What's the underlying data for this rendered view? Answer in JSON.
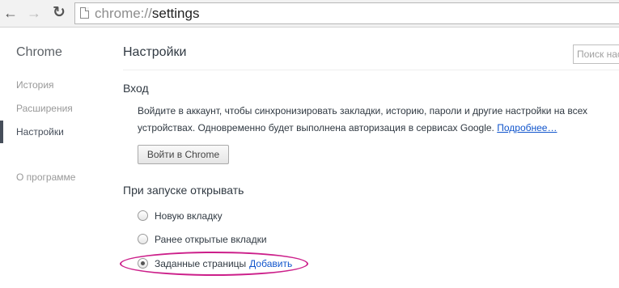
{
  "toolbar": {
    "back_icon": "arrow-left-icon",
    "forward_icon": "arrow-right-icon",
    "reload_icon": "reload-icon",
    "url_scheme": "chrome://",
    "url_host": "settings"
  },
  "sidebar": {
    "brand": "Chrome",
    "items": [
      {
        "label": "История"
      },
      {
        "label": "Расширения"
      },
      {
        "label": "Настройки"
      },
      {
        "label": "О программе"
      }
    ]
  },
  "main": {
    "title": "Настройки",
    "search_placeholder": "Поиск настроек",
    "signin": {
      "heading": "Вход",
      "text": "Войдите в аккаунт, чтобы синхронизировать закладки, историю, пароли и другие настройки на всех устройствах. Одновременно будет выполнена авторизация в сервисах Google. ",
      "more_link": "Подробнее…",
      "button": "Войти в Chrome"
    },
    "startup": {
      "heading": "При запуске открывать",
      "options": [
        {
          "label": "Новую вкладку",
          "checked": false
        },
        {
          "label": "Ранее открытые вкладки",
          "checked": false
        },
        {
          "label": "Заданные страницы",
          "checked": true,
          "link": "Добавить"
        }
      ]
    }
  },
  "colors": {
    "highlight": "#cc1f8a",
    "link": "#1155cc"
  }
}
